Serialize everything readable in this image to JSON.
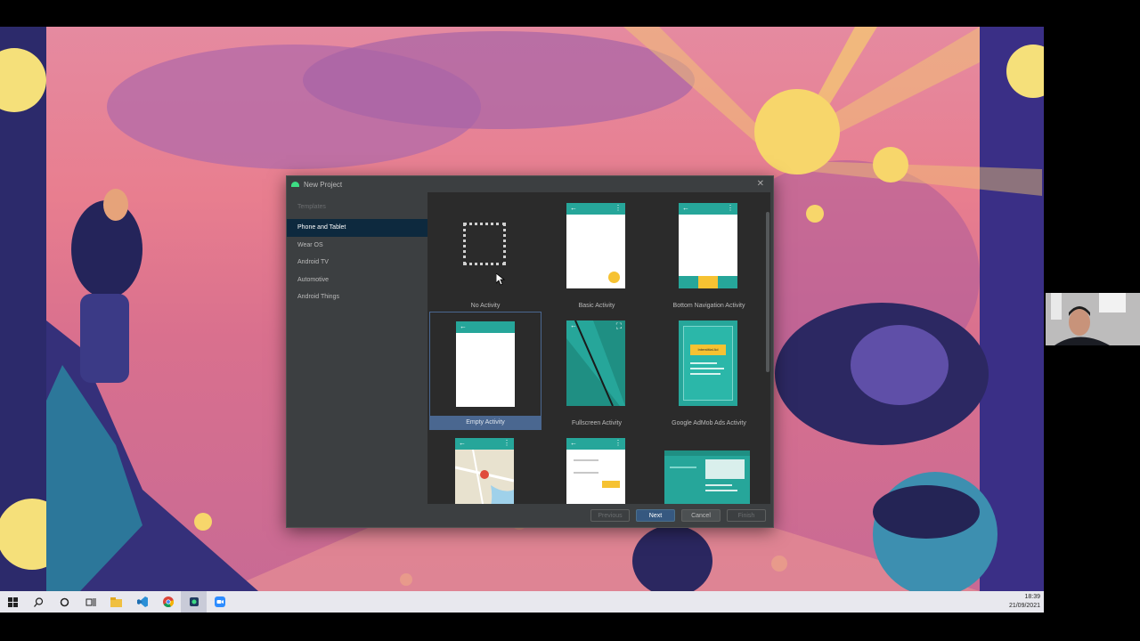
{
  "dialog": {
    "title": "New Project",
    "sidebar_title": "Templates",
    "categories": [
      "Phone and Tablet",
      "Wear OS",
      "Android TV",
      "Automotive",
      "Android Things"
    ],
    "selected_category": "Phone and Tablet",
    "templates": [
      {
        "label": "No Activity",
        "selected": false
      },
      {
        "label": "Basic Activity",
        "selected": false
      },
      {
        "label": "Bottom Navigation Activity",
        "selected": false
      },
      {
        "label": "Empty Activity",
        "selected": true
      },
      {
        "label": "Fullscreen Activity",
        "selected": false
      },
      {
        "label": "Google AdMob Ads Activity",
        "selected": false
      },
      {
        "label": "",
        "selected": false
      },
      {
        "label": "",
        "selected": false
      },
      {
        "label": "",
        "selected": false
      }
    ],
    "admob_badge": "Interstitial Ad",
    "buttons": {
      "previous": "Previous",
      "next": "Next",
      "cancel": "Cancel",
      "finish": "Finish"
    }
  },
  "taskbar": {
    "time": "18:39",
    "date": "21/09/2021",
    "icons": [
      "windows-start-icon",
      "search-icon",
      "cortana-icon",
      "task-view-icon",
      "file-explorer-icon",
      "vscode-icon",
      "chrome-icon",
      "android-studio-icon",
      "zoom-icon"
    ]
  },
  "colors": {
    "accent": "#26a69a",
    "selection": "#4a6790",
    "dialog_bg": "#3c3f41",
    "gallery_bg": "#2b2b2b"
  }
}
